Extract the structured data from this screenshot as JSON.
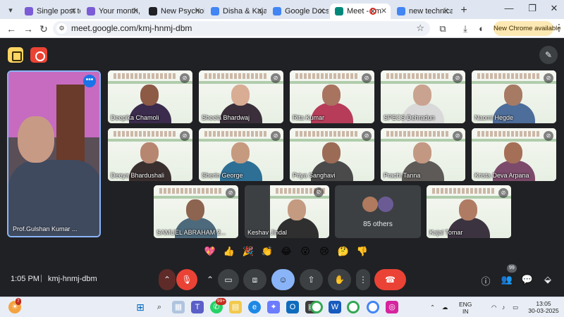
{
  "browser": {
    "tabs": [
      {
        "title": "Single post te",
        "color": "#7b5cd6",
        "active": false
      },
      {
        "title": "Your month, y",
        "color": "#7b5cd6",
        "active": false
      },
      {
        "title": "New Psycholo",
        "color": "#202124",
        "active": false
      },
      {
        "title": "Disha & Kajal",
        "color": "#4285f4",
        "active": false
      },
      {
        "title": "Google Docs",
        "color": "#4285f4",
        "active": false
      },
      {
        "title": "Meet - km",
        "color": "#00897b",
        "active": true
      },
      {
        "title": "new technical",
        "color": "#4285f4",
        "active": false
      }
    ],
    "new_tab": "+",
    "window": {
      "minimize": "—",
      "restore": "❐",
      "close": "✕"
    },
    "url": "meet.google.com/kmj-hnmj-dbm",
    "new_chrome": "New Chrome available"
  },
  "meet": {
    "speaker": {
      "name": "Prof.Gulshan Kumar ...",
      "more": "•••"
    },
    "participants": [
      {
        "name": "Deepika Chamoli",
        "muted": true,
        "skin": "#8d5a45",
        "top": "#3b2b4d"
      },
      {
        "name": "Sheela Bhardwaj",
        "muted": true,
        "skin": "#d8ad94",
        "top": "#3a2f3a"
      },
      {
        "name": "Rita Kumar",
        "muted": true,
        "skin": "#a8735f",
        "top": "#b63c5a"
      },
      {
        "name": "SPECS Dehradun",
        "muted": true,
        "skin": "#c9a38f",
        "top": "#d9d9d9"
      },
      {
        "name": "Naomi Hegde",
        "muted": true,
        "skin": "#a77a64",
        "top": "#4d6d9a"
      },
      {
        "name": "Deeya Bhardushali",
        "muted": true,
        "skin": "#b78670",
        "top": "#3a2f2f"
      },
      {
        "name": "Sherin George",
        "muted": true,
        "skin": "#c69a7f",
        "top": "#2e6f95"
      },
      {
        "name": "Priya Sanghavi",
        "muted": true,
        "skin": "#9b6b56",
        "top": "#4a4a4a"
      },
      {
        "name": "Prachi Tanna",
        "muted": true,
        "skin": "#c39882",
        "top": "#5e5a57"
      },
      {
        "name": "Krista Deva Arpana",
        "muted": true,
        "skin": "#a56f57",
        "top": "#7c4a6b"
      },
      {
        "name": "SAMUEL ABRAHAM 2...",
        "muted": true,
        "skin": "#8d6450",
        "top": "#4d6a7c"
      },
      {
        "name": "Keshav Jindal",
        "muted": false,
        "skin": "#c49a80",
        "top": "#2f2f2f"
      },
      {
        "name": "Kajal Tomar",
        "muted": true,
        "skin": "#b07b63",
        "top": "#3c3340"
      }
    ],
    "others_label": "85 others",
    "reactions": [
      "💖",
      "👍",
      "🎉",
      "👏",
      "😂",
      "😮",
      "😢",
      "🤔",
      "👎"
    ],
    "bottom": {
      "time": "1:05 PM",
      "separator": "|",
      "code": "kmj-hnmj-dbm",
      "people_badge": "99"
    }
  },
  "taskbar": {
    "weather_badge": "7",
    "teams_badge": "99+",
    "lang": "ENG",
    "region": "IN",
    "clock_time": "13:05",
    "clock_date": "30-03-2025"
  }
}
